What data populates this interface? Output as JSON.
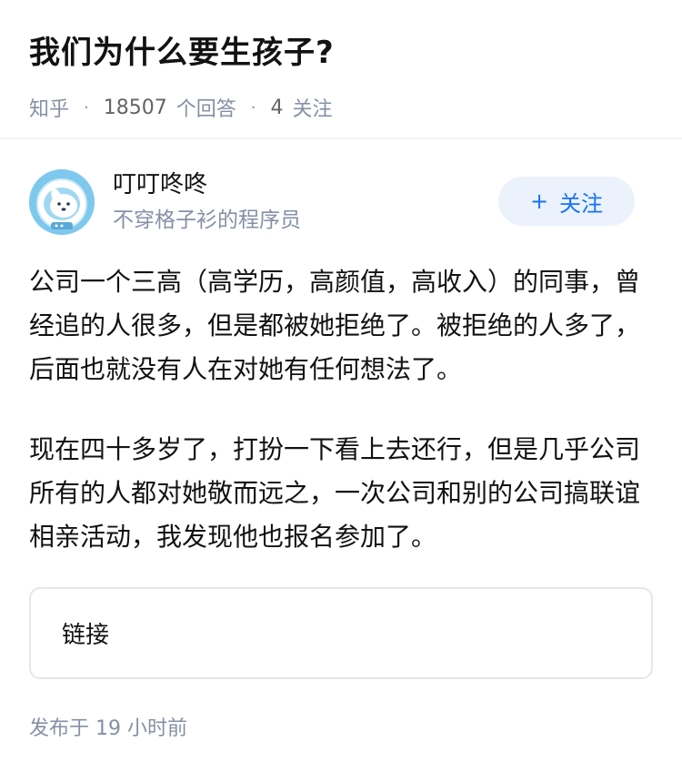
{
  "question": {
    "title": "我们为什么要生孩子?",
    "source": "知乎",
    "answer_count": "18507",
    "answer_label": "个回答",
    "follow_count": "4",
    "follow_label": "关注",
    "separator": "·"
  },
  "author": {
    "name": "叮叮咚咚",
    "bio": "不穿格子衫的程序员",
    "follow_plus": "+",
    "follow_label": "关注"
  },
  "answer": {
    "paragraphs": [
      "公司一个三高（高学历，高颜值，高收入）的同事，曾经追的人很多，但是都被她拒绝了。被拒绝的人多了，后面也就没有人在对她有任何想法了。",
      "现在四十多岁了，打扮一下看上去还行，但是几乎公司所有的人都对她敬而远之，一次公司和别的公司搞联谊相亲活动，我发现他也报名参加了。"
    ],
    "link_label": "链接",
    "published": "发布于  19 小时前"
  },
  "colors": {
    "accent": "#1772f6",
    "accent_bg": "#ebf2fb",
    "meta_gray": "#8590a6",
    "avatar_blue": "#7ec8ee"
  }
}
